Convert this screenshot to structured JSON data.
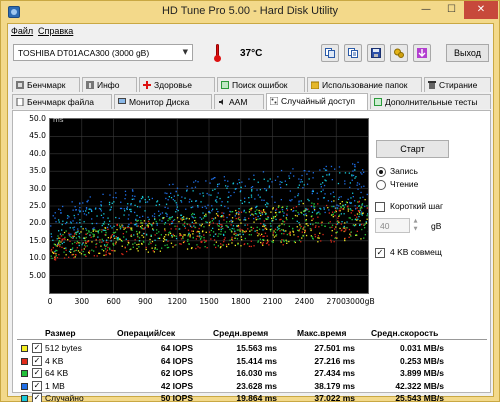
{
  "window": {
    "title": "HD Tune Pro 5.00 - Hard Disk Utility",
    "controls": {
      "minimize": "—",
      "maximize": "☐",
      "close": "✕"
    }
  },
  "menu": {
    "file": "Файл",
    "help": "Справка"
  },
  "toolbar": {
    "drive": "TOSHIBA DT01ACA300 (3000 gB)",
    "temperature": "37°C",
    "exit_label": "Выход",
    "icons": [
      "copy-icon",
      "copy-text-icon",
      "save-icon",
      "gears-icon",
      "download-icon"
    ]
  },
  "tabs_row1": [
    {
      "label": "Бенчмарк",
      "icon": "benchmark-icon"
    },
    {
      "label": "Инфо",
      "icon": "info-icon"
    },
    {
      "label": "Здоровье",
      "icon": "health-icon"
    },
    {
      "label": "Поиск ошибок",
      "icon": "error-scan-icon"
    },
    {
      "label": "Использование папок",
      "icon": "folder-icon"
    },
    {
      "label": "Стирание",
      "icon": "erase-icon"
    }
  ],
  "tabs_row2": [
    {
      "label": "Бенчмарк файла",
      "icon": "file-benchmark-icon"
    },
    {
      "label": "Монитор Диска",
      "icon": "monitor-icon"
    },
    {
      "label": "AAM",
      "icon": "aam-icon"
    },
    {
      "label": "Случайный доступ",
      "icon": "random-access-icon",
      "active": true
    },
    {
      "label": "Дополнительные  тесты",
      "icon": "extra-tests-icon"
    }
  ],
  "controls": {
    "start_label": "Старт",
    "write_label": "Запись",
    "read_label": "Чтение",
    "mode": "write",
    "short_stroke_label": "Короткий шаг",
    "short_stroke_checked": false,
    "short_stroke_value": "40",
    "short_stroke_unit": "gB",
    "align_label": "4 KB совмещ",
    "align_checked": true
  },
  "chart_data": {
    "type": "scatter",
    "ylabel": "ms",
    "ylim": [
      0,
      50
    ],
    "xlim": [
      0,
      3000
    ],
    "x_unit": "gB",
    "y_ticks": [
      "50.0",
      "45.0",
      "40.0",
      "35.0",
      "30.0",
      "25.0",
      "20.0",
      "15.0",
      "10.0",
      "5.00"
    ],
    "x_ticks": [
      "0",
      "300",
      "600",
      "900",
      "1200",
      "1500",
      "1800",
      "2100",
      "2400",
      "2700",
      "3000gB"
    ],
    "series": [
      {
        "name": "512 bytes",
        "color": "#f4ee22",
        "avg_ms": 15.563,
        "max_ms": 27.501
      },
      {
        "name": "4 KB",
        "color": "#e02a1a",
        "avg_ms": 15.414,
        "max_ms": 27.216
      },
      {
        "name": "64 KB",
        "color": "#22c13a",
        "avg_ms": 16.03,
        "max_ms": 27.434
      },
      {
        "name": "1 MB",
        "color": "#1f6fe8",
        "avg_ms": 23.628,
        "max_ms": 38.179
      },
      {
        "name": "Случайно",
        "color": "#17c8d8",
        "avg_ms": 19.864,
        "max_ms": 37.022
      }
    ]
  },
  "results": {
    "headers": [
      "Размер",
      "Операций/сек",
      "Средн.время",
      "Макс.время",
      "Средн.скорость"
    ],
    "rows": [
      {
        "size": "512 bytes",
        "color": "#f4ee22",
        "iops": "64 IOPS",
        "avg": "15.563 ms",
        "max": "27.501 ms",
        "speed": "0.031 MB/s"
      },
      {
        "size": "4 KB",
        "color": "#e02a1a",
        "iops": "64 IOPS",
        "avg": "15.414 ms",
        "max": "27.216 ms",
        "speed": "0.253 MB/s"
      },
      {
        "size": "64 KB",
        "color": "#22c13a",
        "iops": "62 IOPS",
        "avg": "16.030 ms",
        "max": "27.434 ms",
        "speed": "3.899 MB/s"
      },
      {
        "size": "1 MB",
        "color": "#1f6fe8",
        "iops": "42 IOPS",
        "avg": "23.628 ms",
        "max": "38.179 ms",
        "speed": "42.322 MB/s"
      },
      {
        "size": "Случайно",
        "color": "#17c8d8",
        "iops": "50 IOPS",
        "avg": "19.864 ms",
        "max": "37.022 ms",
        "speed": "25.543 MB/s"
      }
    ]
  }
}
